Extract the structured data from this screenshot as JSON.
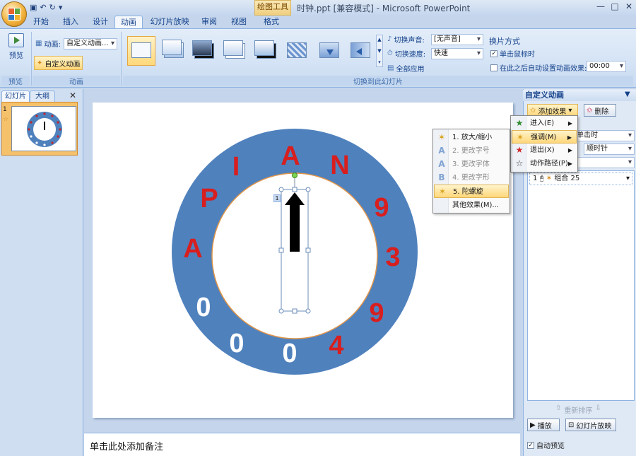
{
  "window": {
    "title": "时钟.ppt [兼容模式] - Microsoft PowerPoint",
    "context_tool": "绘图工具",
    "qat": {
      "undo": "↶",
      "redo": "↻"
    },
    "controls": {
      "min": "—",
      "max": "□",
      "close": "✕"
    }
  },
  "tabs": [
    "开始",
    "插入",
    "设计",
    "动画",
    "幻灯片放映",
    "审阅",
    "视图",
    "格式"
  ],
  "active_tab": "动画",
  "ribbon": {
    "preview": {
      "label": "预览",
      "group": "预览"
    },
    "animation": {
      "label": "动画:",
      "value": "自定义动画...",
      "custom_btn": "自定义动画",
      "group": "动画"
    },
    "transition": {
      "group": "切换到此幻灯片",
      "sound_label": "切换声音:",
      "sound_value": "[无声音]",
      "speed_label": "切换速度:",
      "speed_value": "快速",
      "apply_all": "全部应用",
      "advance_title": "换片方式",
      "on_click": "单击鼠标时",
      "after_label": "在此之后自动设置动画效果:",
      "after_value": "00:00"
    }
  },
  "left_panel": {
    "tab_slides": "幻灯片",
    "tab_outline": "大纲",
    "slide_number": "1"
  },
  "slide": {
    "ring_letters": [
      "A",
      "N",
      "9",
      "3",
      "9",
      "4",
      "0",
      "0",
      "0",
      "A",
      "P",
      "I"
    ],
    "colors": {
      "ring": "#4f81bd",
      "red": "#d81e1e",
      "white": "#ffffff",
      "inner_border": "#e0954a"
    },
    "anim_tag": "1"
  },
  "notes_placeholder": "单击此处添加备注",
  "right_pane": {
    "title": "自定义动画",
    "add_effect": "添加效果",
    "delete": "删除",
    "field_start": "单击时",
    "field_property": "顺时针",
    "list_item": {
      "index": "1",
      "label": "组合 25"
    },
    "reorder": "重新排序",
    "play": "播放",
    "slideshow": "幻灯片放映",
    "auto_preview": "自动预览"
  },
  "menus": {
    "add_effect_submenu": [
      {
        "label": "进入(E)",
        "icon": "star-green-icon"
      },
      {
        "label": "强调(M)",
        "icon": "star-yellow-icon",
        "highlighted": true
      },
      {
        "label": "退出(X)",
        "icon": "star-red-icon"
      },
      {
        "label": "动作路径(P)",
        "icon": "star-outline-icon"
      }
    ],
    "emphasis_menu": [
      {
        "label": "1. 放大/缩小",
        "enabled": true
      },
      {
        "label": "2. 更改字号",
        "enabled": false
      },
      {
        "label": "3. 更改字体",
        "enabled": false
      },
      {
        "label": "4. 更改字形",
        "enabled": false
      },
      {
        "label": "5. 陀螺旋",
        "enabled": true,
        "highlighted": true
      },
      {
        "label": "其他效果(M)...",
        "enabled": true
      }
    ]
  }
}
